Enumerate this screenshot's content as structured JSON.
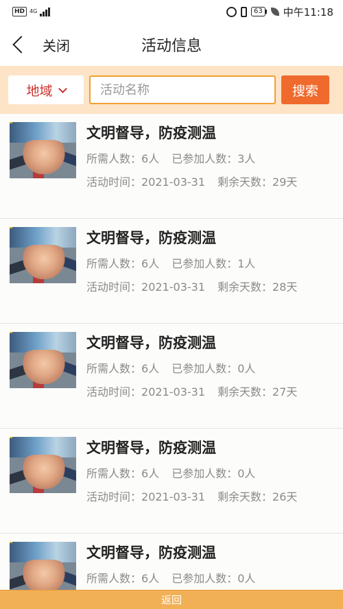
{
  "status_bar": {
    "left_badge": "HD",
    "network": "4G",
    "battery": "63",
    "time": "中午11:18"
  },
  "header": {
    "close_label": "关闭",
    "title": "活动信息"
  },
  "search": {
    "region_label": "地域",
    "placeholder": "活动名称",
    "button_label": "搜索"
  },
  "labels": {
    "required": "所需人数：",
    "joined": "已参加人数：",
    "date": "活动时间：",
    "remaining": "剩余天数："
  },
  "activities": [
    {
      "title": "文明督导，防疫测温",
      "required": "6人",
      "joined": "3人",
      "date": "2021-03-31",
      "remaining": "29天"
    },
    {
      "title": "文明督导，防疫测温",
      "required": "6人",
      "joined": "1人",
      "date": "2021-03-31",
      "remaining": "28天"
    },
    {
      "title": "文明督导，防疫测温",
      "required": "6人",
      "joined": "0人",
      "date": "2021-03-31",
      "remaining": "27天"
    },
    {
      "title": "文明督导，防疫测温",
      "required": "6人",
      "joined": "0人",
      "date": "2021-03-31",
      "remaining": "26天"
    },
    {
      "title": "文明督导，防疫测温",
      "required": "6人",
      "joined": "0人",
      "date": "",
      "remaining": ""
    }
  ],
  "footer": {
    "back_label": "返回"
  },
  "colors": {
    "accent": "#ef6a2c",
    "search_bg": "#fde4c7",
    "region_text": "#c8302b",
    "footer_bg": "#f2b056"
  }
}
